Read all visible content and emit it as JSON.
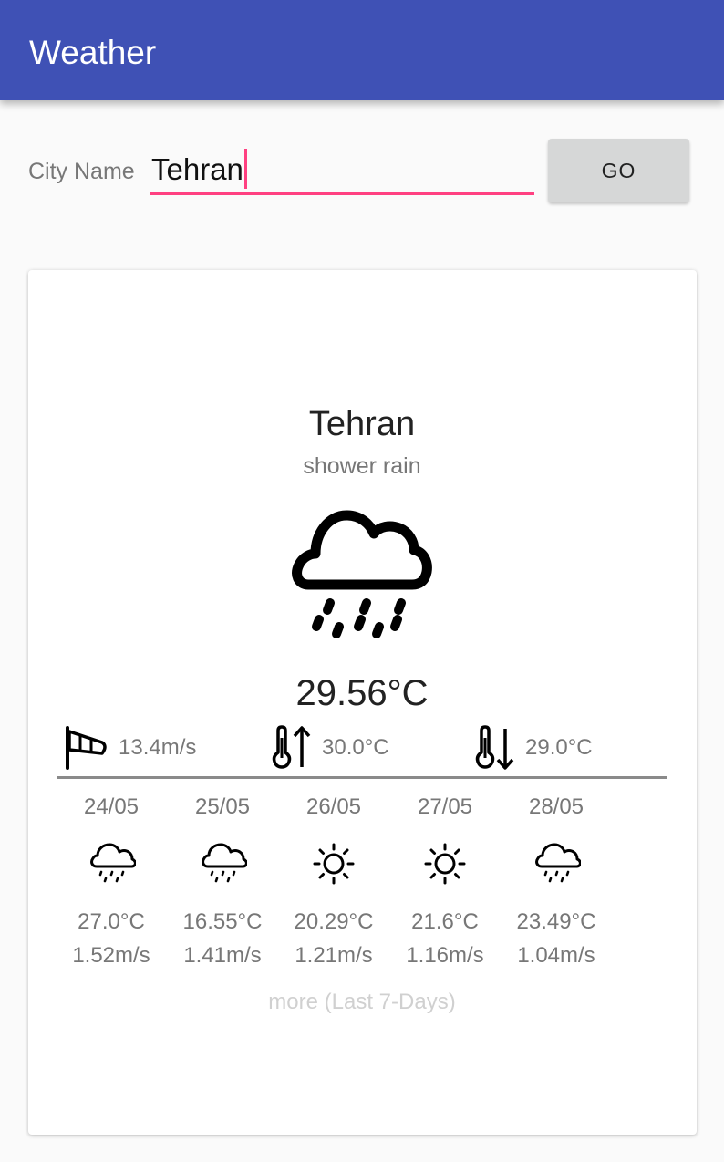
{
  "app": {
    "title": "Weather"
  },
  "search": {
    "label": "City Name",
    "value": "Tehran",
    "button_label": "GO"
  },
  "current": {
    "city": "Tehran",
    "description": "shower rain",
    "icon": "shower-rain-icon",
    "temperature": "29.56°C",
    "wind": "13.4m/s",
    "temp_max": "30.0°C",
    "temp_min": "29.0°C"
  },
  "forecast": [
    {
      "date": "24/05",
      "icon": "shower-rain-icon",
      "temp": "27.0°C",
      "wind": "1.52m/s"
    },
    {
      "date": "25/05",
      "icon": "shower-rain-icon",
      "temp": "16.55°C",
      "wind": "1.41m/s"
    },
    {
      "date": "26/05",
      "icon": "sun-icon",
      "temp": "20.29°C",
      "wind": "1.21m/s"
    },
    {
      "date": "27/05",
      "icon": "sun-icon",
      "temp": "21.6°C",
      "wind": "1.16m/s"
    },
    {
      "date": "28/05",
      "icon": "shower-rain-icon",
      "temp": "23.49°C",
      "wind": "1.04m/s"
    }
  ],
  "more_link": "more (Last 7-Days)",
  "colors": {
    "primary": "#3f51b5",
    "accent": "#ff4081"
  }
}
